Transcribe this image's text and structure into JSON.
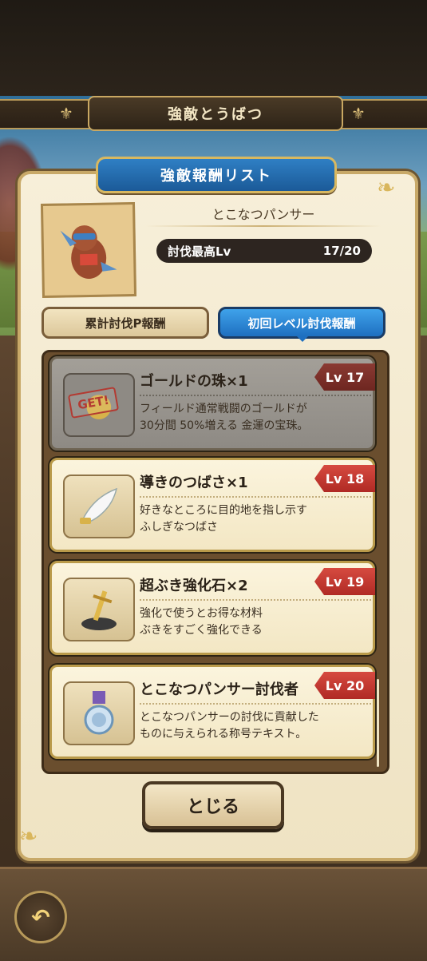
{
  "screen_title": "強敵とうばつ",
  "panel_title": "強敵報酬リスト",
  "monster": {
    "name": "とこなつパンサー",
    "level_label": "討伐最高Lv",
    "level_value": "17/20"
  },
  "tabs": [
    {
      "label": "累計討伐P報酬",
      "active": false
    },
    {
      "label": "初回レベル討伐報酬",
      "active": true
    }
  ],
  "rewards": [
    {
      "name": "ゴールドの珠×1",
      "level": "Lv 17",
      "desc1": "フィールド通常戦闘のゴールドが",
      "desc2": "30分間 50%増える 金運の宝珠。",
      "claimed": true,
      "stamp": "GET!",
      "icon": "gold-orb-icon"
    },
    {
      "name": "導きのつばさ×1",
      "level": "Lv 18",
      "desc1": "好きなところに目的地を指し示す",
      "desc2": "ふしぎなつばさ",
      "claimed": false,
      "icon": "wing-icon"
    },
    {
      "name": "超ぶき強化石×2",
      "level": "Lv 19",
      "desc1": "強化で使うとお得な材料",
      "desc2": "ぶきをすごく強化できる",
      "claimed": false,
      "icon": "sword-stone-icon"
    },
    {
      "name": "とこなつパンサー討伐者",
      "level": "Lv 20",
      "desc1": "とこなつパンサーの討伐に貢献した",
      "desc2": "ものに与えられる称号テキスト。",
      "claimed": false,
      "icon": "medal-icon"
    }
  ],
  "close_label": "とじる",
  "colors": {
    "accent_blue": "#1e6fc0",
    "level_badge_red": "#c0352d",
    "gold_trim": "#c8a968"
  }
}
